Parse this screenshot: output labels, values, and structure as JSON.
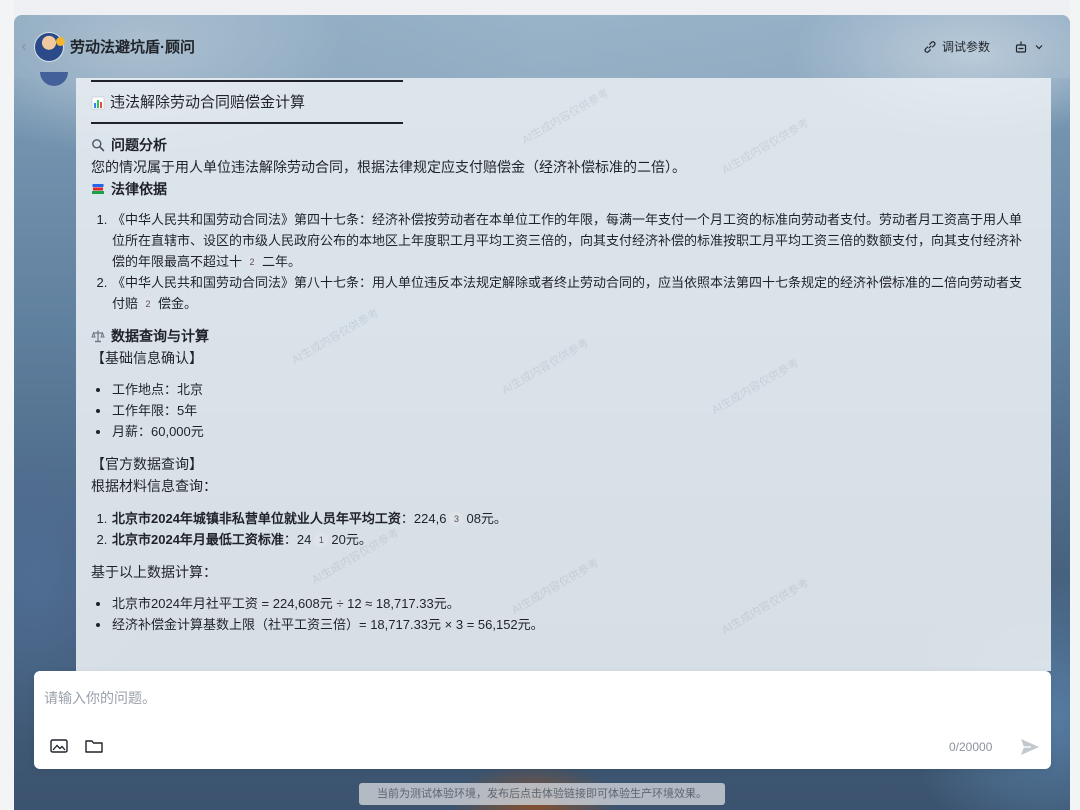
{
  "header": {
    "back_icon": "chevron-left-icon",
    "title": "劳动法避坑盾·顾问",
    "debug_label": "调试参数",
    "debug_icon": "link-icon",
    "agent_icon": "robot-icon"
  },
  "message": {
    "title": "违法解除劳动合同赔偿金计算",
    "title_icon": "bar-chart-icon",
    "analysis": {
      "heading": "问题分析",
      "icon": "search-icon",
      "text": "您的情况属于用人单位违法解除劳动合同，根据法律规定应支付赔偿金（经济补偿标准的二倍）。"
    },
    "legal_basis": {
      "heading": "法律依据",
      "icon": "books-icon",
      "items": [
        {
          "pre": "《中华人民共和国劳动合同法》第四十七条：经济补偿按劳动者在本单位工作的年限，每满一年支付一个月工资的标准向劳动者支付。劳动者月工资高于用人单位所在直辖市、设区的市级人民政府公布的本地区上年度职工月平均工资三倍的，向其支付经济补偿的标准按职工月平均工资三倍的数额支付，向其支付经济补偿的年限最高不超过十",
          "cite": "2",
          "post": "二年。"
        },
        {
          "pre": "《中华人民共和国劳动合同法》第八十七条：用人单位违反本法规定解除或者终止劳动合同的，应当依照本法第四十七条规定的经济补偿标准的二倍向劳动者支付赔",
          "cite": "2",
          "post": "偿金。"
        }
      ]
    },
    "calc": {
      "heading": "数据查询与计算",
      "icon": "scale-icon",
      "basic_heading": "【基础信息确认】",
      "basic_items": [
        "工作地点：北京",
        "工作年限：5年",
        "月薪：60,000元"
      ],
      "official_heading": "【官方数据查询】",
      "official_intro": "根据材料信息查询：",
      "official_items": [
        {
          "label": "北京市2024年城镇非私营单位就业人员年平均工资",
          "pre": "：224,6",
          "cite": "3",
          "post": "08元。"
        },
        {
          "label": "北京市2024年月最低工资标准",
          "pre": "：24",
          "cite": "1",
          "post": "20元。"
        }
      ],
      "based_on": "基于以上数据计算：",
      "results": [
        "北京市2024年月社平工资 = 224,608元 ÷ 12 ≈ 18,717.33元。",
        "经济补偿金计算基数上限（社平工资三倍）= 18,717.33元 × 3 = 56,152元。"
      ]
    }
  },
  "input": {
    "placeholder": "请输入你的问题。",
    "value": "",
    "counter": "0/20000",
    "image_icon": "image-icon",
    "folder_icon": "folder-icon",
    "send_icon": "send-icon"
  },
  "footer": {
    "note": "当前为测试体验环境，发布后点击体验链接即可体验生产环境效果。"
  },
  "watermark": "AI生成内容仅供参考",
  "colors": {
    "text": "#1f2329",
    "muted": "#8a939e",
    "panel": "#e8edf2",
    "chart_icon_bars": [
      "#3b82f6",
      "#22c55e",
      "#ef4444"
    ]
  }
}
